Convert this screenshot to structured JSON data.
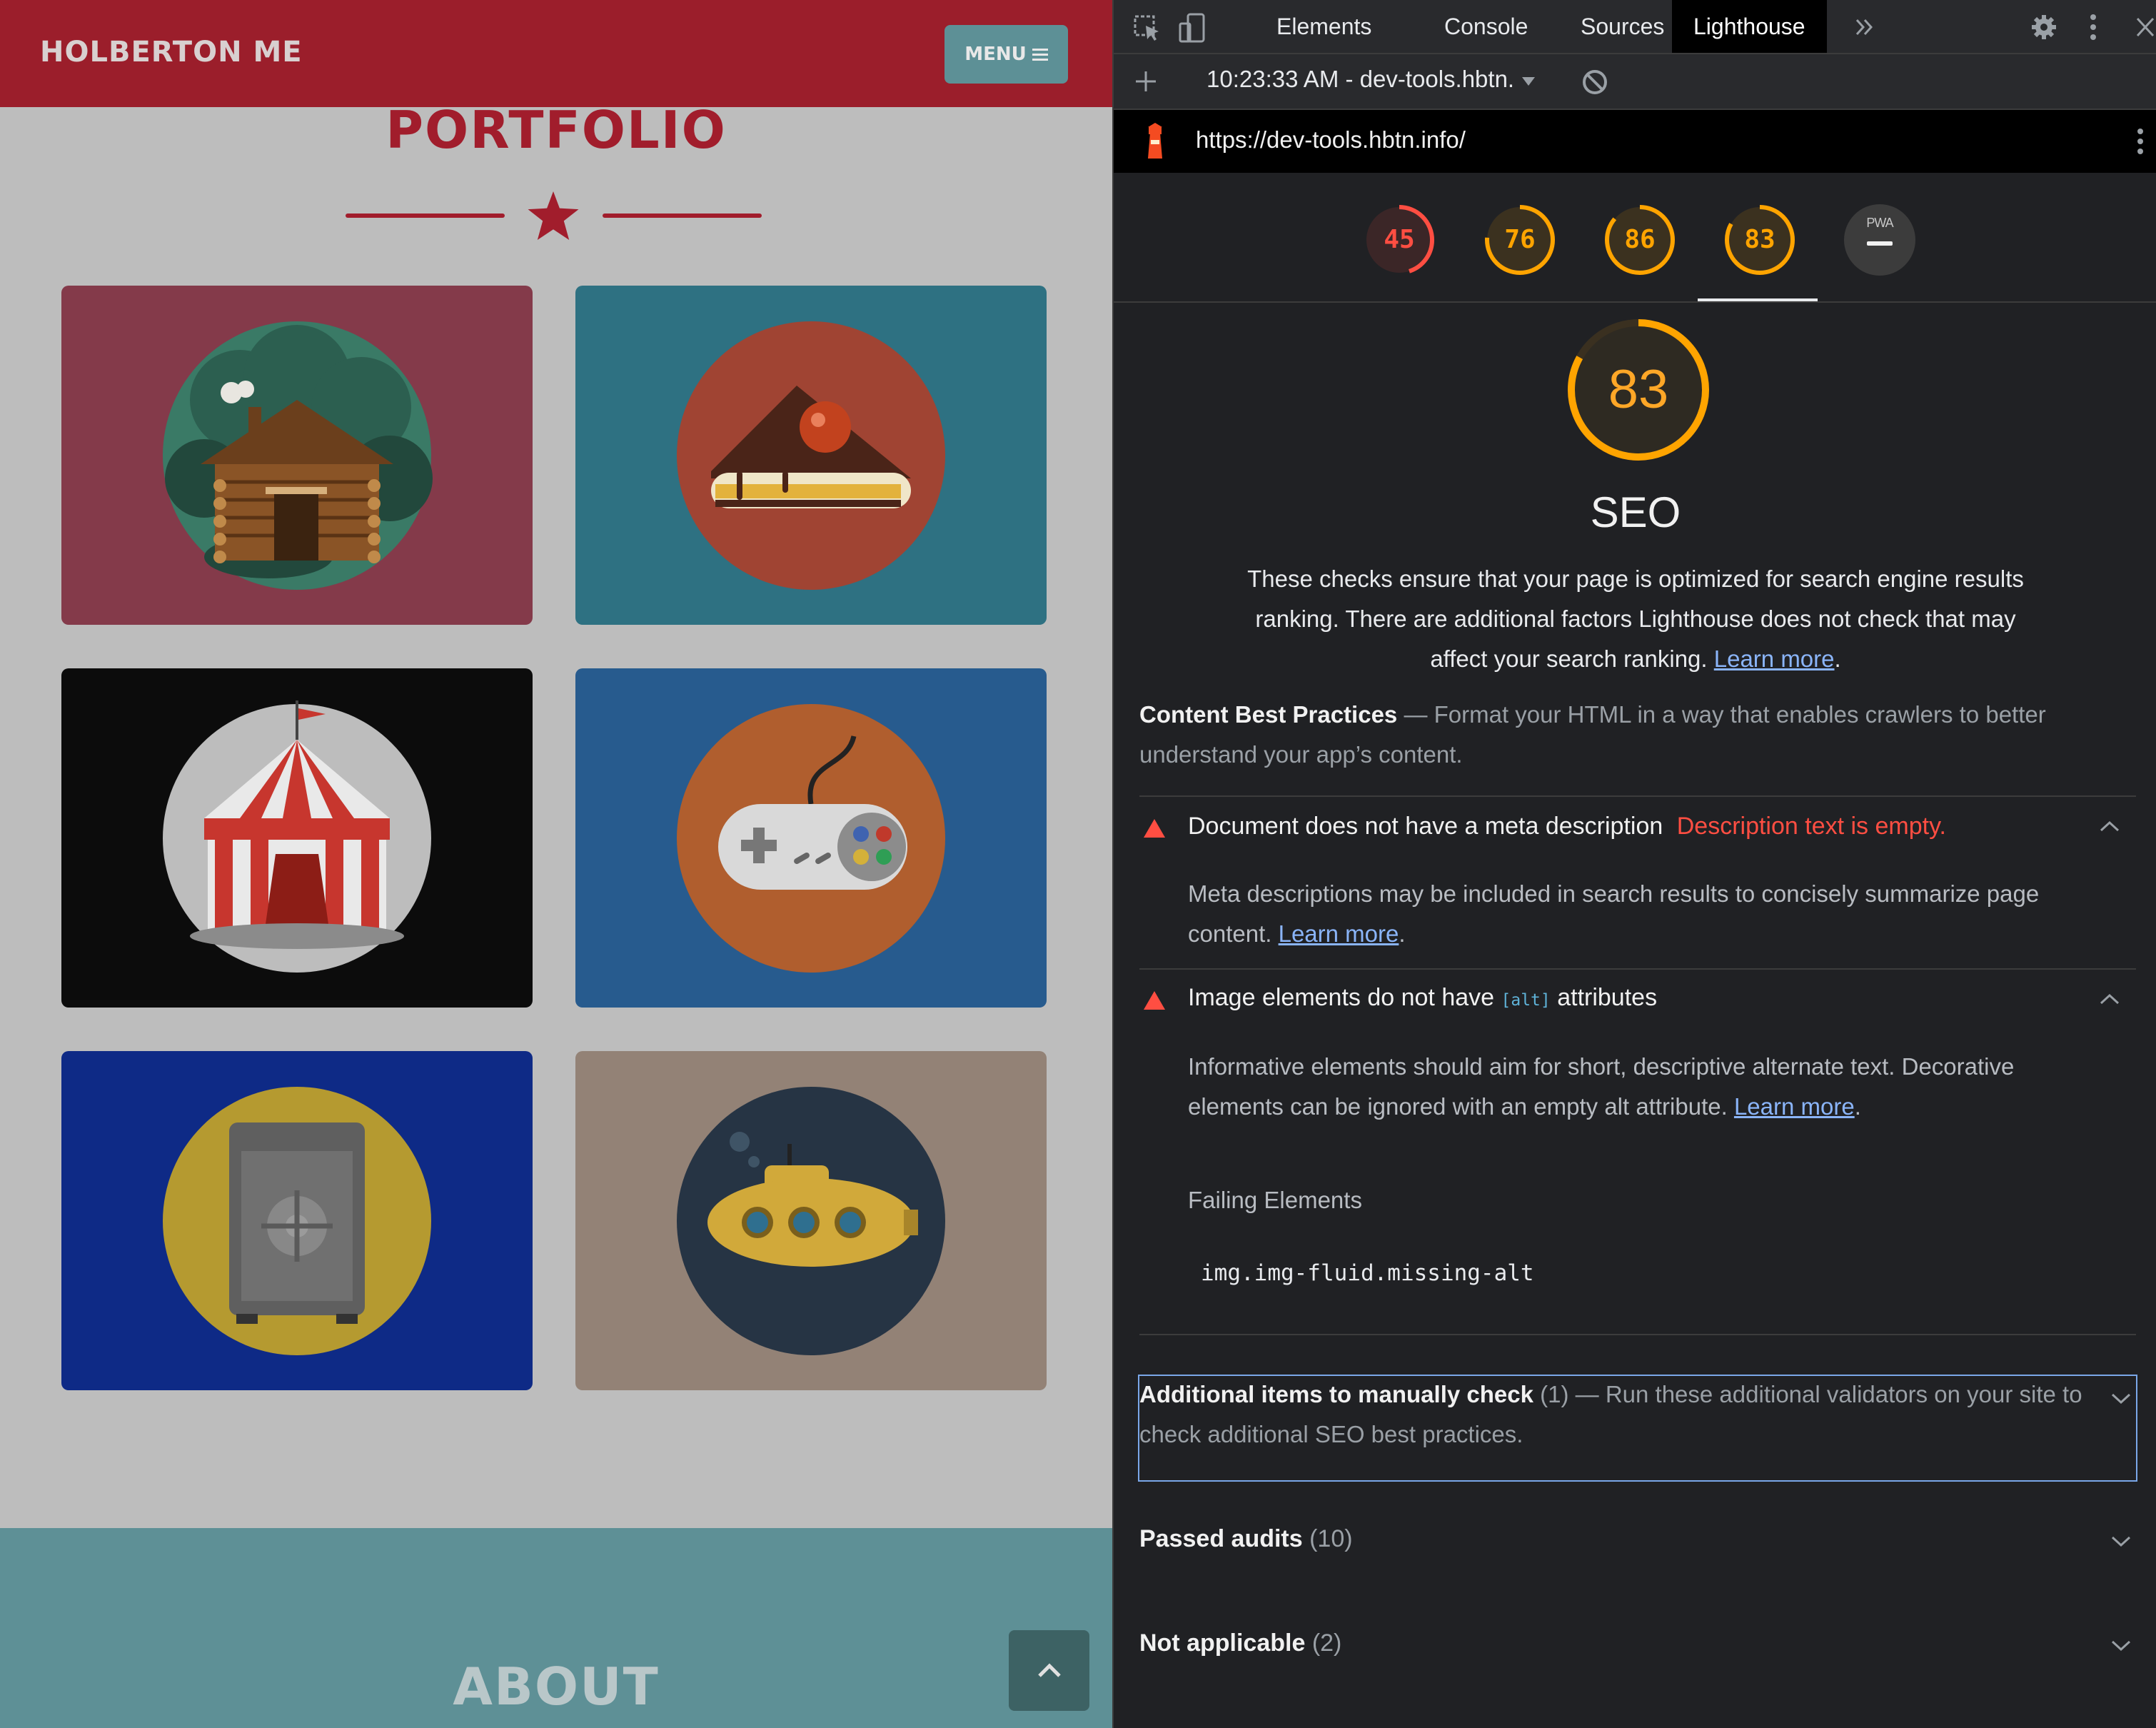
{
  "site": {
    "brand": "HOLBERTON ME",
    "menu_label": "MENU",
    "portfolio_title": "PORTFOLIO",
    "about_title": "ABOUT",
    "tiles": [
      {
        "name": "log-cabin",
        "bg": "#843a4a",
        "circle": "#3a7a66"
      },
      {
        "name": "cake-slice",
        "bg": "#2e7182",
        "circle": "#a04433"
      },
      {
        "name": "circus-tent",
        "bg": "#0c0c0c",
        "circle": "#bdbdbd"
      },
      {
        "name": "game-controller",
        "bg": "#275b8e",
        "circle": "#b05e2e"
      },
      {
        "name": "safe",
        "bg": "#0e2a86",
        "circle": "#b59a30"
      },
      {
        "name": "submarine",
        "bg": "#938276",
        "circle": "#263444"
      }
    ]
  },
  "devtools": {
    "tabs": [
      "Elements",
      "Console",
      "Sources",
      "Lighthouse"
    ],
    "active_tab": "Lighthouse",
    "report_select": "10:23:33 AM - dev-tools.hbtn.",
    "url": "https://dev-tools.hbtn.info/",
    "scores": [
      {
        "value": 45,
        "color": "#ff4e42",
        "fraction": 0.45
      },
      {
        "value": 76,
        "color": "#ffa400",
        "fraction": 0.76
      },
      {
        "value": 86,
        "color": "#ffa400",
        "fraction": 0.86
      },
      {
        "value": 83,
        "color": "#ffa400",
        "fraction": 0.83
      }
    ],
    "pwa_label": "PWA",
    "category": {
      "score": "83",
      "title": "SEO",
      "description": "These checks ensure that your page is optimized for search engine results ranking. There are additional factors Lighthouse does not check that may affect your search ranking.",
      "learn_more": "Learn more"
    },
    "group_content": {
      "title": "Content Best Practices",
      "description": "Format your HTML in a way that enables crawlers to better understand your app’s content."
    },
    "audit_meta": {
      "title": "Document does not have a meta description",
      "display_value": "Description text is empty.",
      "description": "Meta descriptions may be included in search results to concisely summarize page content.",
      "learn_more": "Learn more"
    },
    "audit_alt": {
      "title_before": "Image elements do not have",
      "code": "[alt]",
      "title_after": "attributes",
      "description": "Informative elements should aim for short, descriptive alternate text. Decorative elements can be ignored with an empty alt attribute.",
      "learn_more": "Learn more",
      "failing_label": "Failing Elements",
      "failing_node": "img.img-fluid.missing-alt"
    },
    "group_manual": {
      "title": "Additional items to manually check",
      "count": "(1)",
      "description": "Run these additional validators on your site to check additional SEO best practices."
    },
    "group_passed": {
      "title": "Passed audits",
      "count": "(10)"
    },
    "group_na": {
      "title": "Not applicable",
      "count": "(2)"
    }
  }
}
